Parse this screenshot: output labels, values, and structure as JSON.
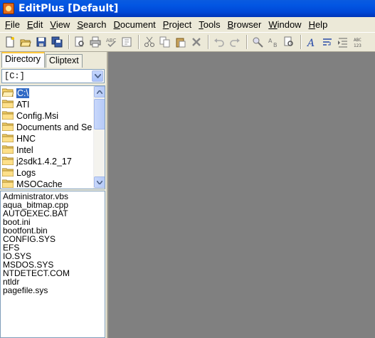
{
  "window": {
    "title": "EditPlus  [Default]"
  },
  "menu": [
    {
      "pre": "",
      "mn": "F",
      "post": "ile"
    },
    {
      "pre": "",
      "mn": "E",
      "post": "dit"
    },
    {
      "pre": "",
      "mn": "V",
      "post": "iew"
    },
    {
      "pre": "",
      "mn": "S",
      "post": "earch"
    },
    {
      "pre": "",
      "mn": "D",
      "post": "ocument"
    },
    {
      "pre": "",
      "mn": "P",
      "post": "roject"
    },
    {
      "pre": "",
      "mn": "T",
      "post": "ools"
    },
    {
      "pre": "",
      "mn": "B",
      "post": "rowser"
    },
    {
      "pre": "",
      "mn": "W",
      "post": "indow"
    },
    {
      "pre": "",
      "mn": "H",
      "post": "elp"
    }
  ],
  "toolbar_icons": [
    "new-file-icon",
    "open-folder-icon",
    "save-icon",
    "save-all-icon",
    "print-preview-icon",
    "print-icon",
    "spell-check-icon",
    "html-preview-icon",
    "cut-icon",
    "copy-icon",
    "paste-icon",
    "delete-icon",
    "undo-icon",
    "redo-icon",
    "find-icon",
    "replace-icon",
    "find-in-files-icon",
    "font-icon",
    "word-wrap-icon",
    "indent-icon",
    "ruler-icon"
  ],
  "tabs": {
    "directory": "Directory",
    "cliptext": "Cliptext"
  },
  "drive": {
    "value": "[C:]"
  },
  "tree": [
    {
      "label": "C:\\",
      "selected": true,
      "open": true
    },
    {
      "label": "ATI"
    },
    {
      "label": "Config.Msi"
    },
    {
      "label": "Documents and Se"
    },
    {
      "label": "HNC"
    },
    {
      "label": "Intel"
    },
    {
      "label": "j2sdk1.4.2_17"
    },
    {
      "label": "Logs"
    },
    {
      "label": "MSOCache"
    }
  ],
  "files": [
    "Administrator.vbs",
    "aqua_bitmap.cpp",
    "AUTOEXEC.BAT",
    "boot.ini",
    "bootfont.bin",
    "CONFIG.SYS",
    "EFS",
    "IO.SYS",
    "MSDOS.SYS",
    "NTDETECT.COM",
    "ntldr",
    "pagefile.sys"
  ]
}
